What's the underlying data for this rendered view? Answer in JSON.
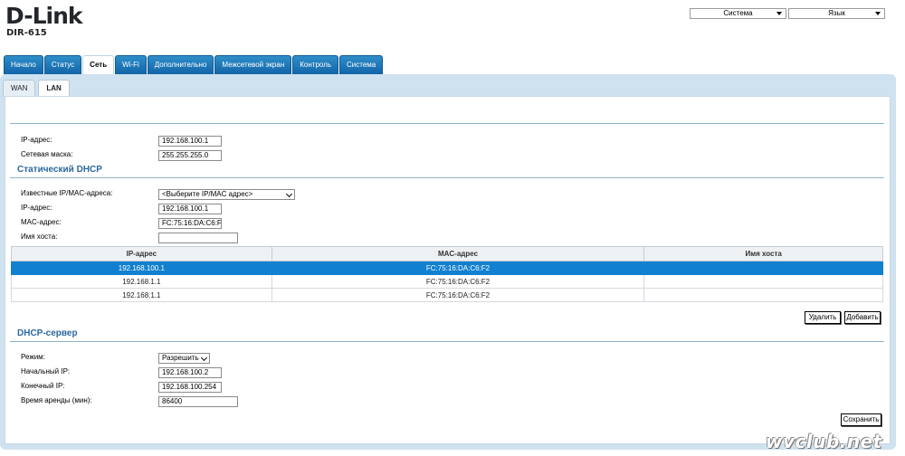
{
  "header": {
    "logo": "D-Link",
    "model": "DIR-615",
    "system_menu": "Система",
    "language_menu": "Язык"
  },
  "main_tabs": [
    {
      "label": "Начало",
      "active": false
    },
    {
      "label": "Статус",
      "active": false
    },
    {
      "label": "Сеть",
      "active": true
    },
    {
      "label": "Wi-Fi",
      "active": false
    },
    {
      "label": "Дополнительно",
      "active": false
    },
    {
      "label": "Межсетевой экран",
      "active": false
    },
    {
      "label": "Контроль",
      "active": false
    },
    {
      "label": "Система",
      "active": false
    }
  ],
  "sub_tabs": [
    {
      "label": "WAN",
      "active": false
    },
    {
      "label": "LAN",
      "active": true
    }
  ],
  "lan": {
    "ip_label": "IP-адрес:",
    "ip_value": "192.168.100.1",
    "mask_label": "Сетевая маска:",
    "mask_value": "255.255.255.0"
  },
  "static_dhcp": {
    "title": "Статический DHCP",
    "known_label": "Известные IP/MAC-адреса:",
    "known_value": "<Выберите IP/MAC адрес>",
    "ip_label": "IP-адрес:",
    "ip_value": "192.168.100.1",
    "mac_label": "MAC-адрес:",
    "mac_value": "FC:75:16:DA:C6:F2",
    "host_label": "Имя хоста:",
    "host_value": "",
    "columns": [
      "IP-адрес",
      "MAC-адрес",
      "Имя хоста"
    ],
    "rows": [
      {
        "ip": "192.168.100.1",
        "mac": "FC:75:16:DA:C6:F2",
        "host": "",
        "selected": true
      },
      {
        "ip": "192.168.1.1",
        "mac": "FC:75:16:DA:C6:F2",
        "host": "",
        "selected": false
      },
      {
        "ip": "192.168.1.1",
        "mac": "FC:75:16:DA:C6:F2",
        "host": "",
        "selected": false
      }
    ],
    "delete_button": "Удалить",
    "add_button": "Добавить"
  },
  "dhcp_server": {
    "title": "DHCP-сервер",
    "mode_label": "Режим:",
    "mode_value": "Разрешить",
    "start_label": "Начальный IP:",
    "start_value": "192.168.100.2",
    "end_label": "Конечный IP:",
    "end_value": "192.168.100.254",
    "lease_label": "Время аренды (мин):",
    "lease_value": "86400",
    "save_button": "Сохранить"
  },
  "watermark": "wvclub.net",
  "colors": {
    "tab_blue": "#1a72b5",
    "selected_row": "#1180d0",
    "section_title": "#2c68a0",
    "panel_bg": "#cfe2f0"
  }
}
